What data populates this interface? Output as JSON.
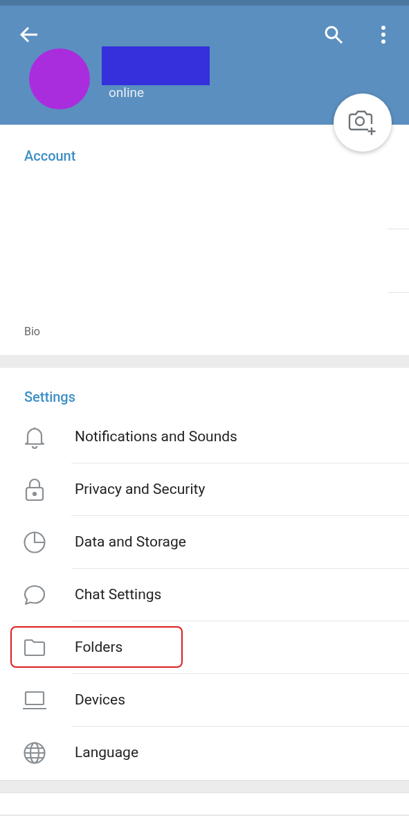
{
  "header": {
    "status": "online"
  },
  "account": {
    "title": "Account",
    "bio_label": "Bio"
  },
  "settings": {
    "title": "Settings",
    "items": [
      {
        "label": "Notifications and Sounds",
        "highlighted": false
      },
      {
        "label": "Privacy and Security",
        "highlighted": false
      },
      {
        "label": "Data and Storage",
        "highlighted": false
      },
      {
        "label": "Chat Settings",
        "highlighted": false
      },
      {
        "label": "Folders",
        "highlighted": true
      },
      {
        "label": "Devices",
        "highlighted": false
      },
      {
        "label": "Language",
        "highlighted": false
      }
    ]
  }
}
